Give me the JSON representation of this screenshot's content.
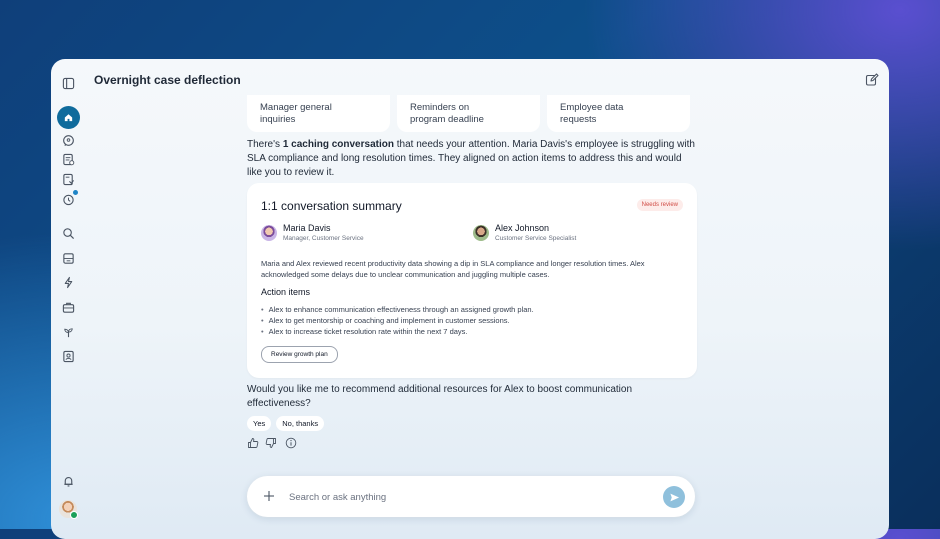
{
  "window": {
    "title": "Overnight case deflection"
  },
  "sidebar": {
    "items": [
      {
        "name": "panel-toggle-icon"
      },
      {
        "name": "home-icon",
        "active": true
      },
      {
        "name": "support-chat-icon"
      },
      {
        "name": "tasks-icon"
      },
      {
        "name": "cases-icon"
      },
      {
        "name": "timer-icon",
        "notification": true
      },
      {
        "name": "search-icon"
      },
      {
        "name": "storage-icon"
      },
      {
        "name": "power-icon"
      },
      {
        "name": "briefcase-icon"
      },
      {
        "name": "plant-icon"
      },
      {
        "name": "contact-icon"
      },
      {
        "name": "bell-icon"
      }
    ]
  },
  "top_cards": [
    {
      "line1": "Manager general",
      "line2": "inquiries"
    },
    {
      "line1": "Reminders on",
      "line2": "program deadline"
    },
    {
      "line1": "Employee data",
      "line2": "requests"
    }
  ],
  "intro": {
    "prefix": "There's ",
    "bold": "1 caching conversation",
    "suffix": " that needs your attention. Maria Davis's employee is struggling with SLA compliance and long resolution times. They aligned on action items to address this and would like you to review it."
  },
  "summary": {
    "title": "1:1 conversation summary",
    "badge": "Needs review",
    "people": [
      {
        "name": "Maria Davis",
        "role": "Manager, Customer Service"
      },
      {
        "name": "Alex Johnson",
        "role": "Customer Service Specialist"
      }
    ],
    "body": "Maria and Alex reviewed recent productivity data showing a dip in SLA compliance and longer resolution times. Alex acknowledged some delays due to unclear communication and juggling multiple cases.",
    "action_items_heading": "Action items",
    "action_items": [
      "Alex to enhance communication effectiveness through an assigned growth plan.",
      "Alex to get mentorship or coaching and implement in customer sessions.",
      "Alex to increase ticket resolution rate within the next 7 days."
    ],
    "button": "Review growth plan"
  },
  "followup": "Would you like me to recommend additional resources for Alex to boost communication effectiveness?",
  "chips": {
    "yes": "Yes",
    "no": "No, thanks"
  },
  "search": {
    "placeholder": "Search or ask anything",
    "value": ""
  },
  "colors": {
    "accent": "#0f6b9c",
    "badge_text": "#d04c45",
    "badge_bg": "#fdecea",
    "send_button": "#8fc0dc"
  }
}
